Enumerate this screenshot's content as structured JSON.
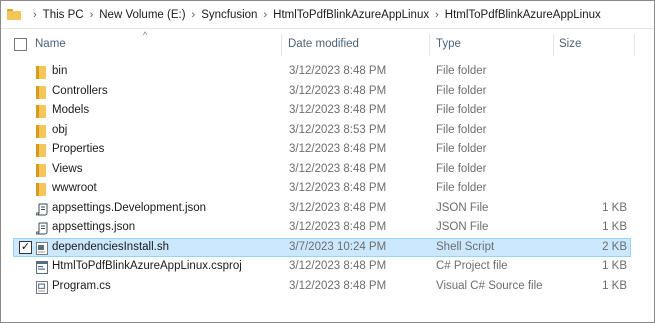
{
  "breadcrumb": {
    "items": [
      "This PC",
      "New Volume (E:)",
      "Syncfusion",
      "HtmlToPdfBlinkAzureAppLinux",
      "HtmlToPdfBlinkAzureAppLinux"
    ],
    "separator": "›"
  },
  "columns": {
    "name": "Name",
    "date": "Date modified",
    "type": "Type",
    "size": "Size"
  },
  "sort_indicator": "^",
  "files": [
    {
      "name": "bin",
      "date": "3/12/2023 8:48 PM",
      "type": "File folder",
      "size": "",
      "icon": "folder-icon"
    },
    {
      "name": "Controllers",
      "date": "3/12/2023 8:48 PM",
      "type": "File folder",
      "size": "",
      "icon": "folder-icon"
    },
    {
      "name": "Models",
      "date": "3/12/2023 8:48 PM",
      "type": "File folder",
      "size": "",
      "icon": "folder-icon"
    },
    {
      "name": "obj",
      "date": "3/12/2023 8:53 PM",
      "type": "File folder",
      "size": "",
      "icon": "folder-icon"
    },
    {
      "name": "Properties",
      "date": "3/12/2023 8:48 PM",
      "type": "File folder",
      "size": "",
      "icon": "folder-icon"
    },
    {
      "name": "Views",
      "date": "3/12/2023 8:48 PM",
      "type": "File folder",
      "size": "",
      "icon": "folder-icon"
    },
    {
      "name": "wwwroot",
      "date": "3/12/2023 8:48 PM",
      "type": "File folder",
      "size": "",
      "icon": "folder-icon"
    },
    {
      "name": "appsettings.Development.json",
      "date": "3/12/2023 8:48 PM",
      "type": "JSON File",
      "size": "1 KB",
      "icon": "json-file-icon"
    },
    {
      "name": "appsettings.json",
      "date": "3/12/2023 8:48 PM",
      "type": "JSON File",
      "size": "1 KB",
      "icon": "json-file-icon"
    },
    {
      "name": "dependenciesInstall.sh",
      "date": "3/7/2023 10:24 PM",
      "type": "Shell Script",
      "size": "2 KB",
      "icon": "shell-script-icon",
      "selected": true
    },
    {
      "name": "HtmlToPdfBlinkAzureAppLinux.csproj",
      "date": "3/12/2023 8:48 PM",
      "type": "C# Project file",
      "size": "1 KB",
      "icon": "csproj-file-icon"
    },
    {
      "name": "Program.cs",
      "date": "3/12/2023 8:48 PM",
      "type": "Visual C# Source file",
      "size": "1 KB",
      "icon": "cs-file-icon"
    }
  ],
  "colors": {
    "selection_bg": "#cce8ff",
    "selection_border": "#99d1ff",
    "header_text": "#4c607a",
    "folder": "#f5c659"
  }
}
